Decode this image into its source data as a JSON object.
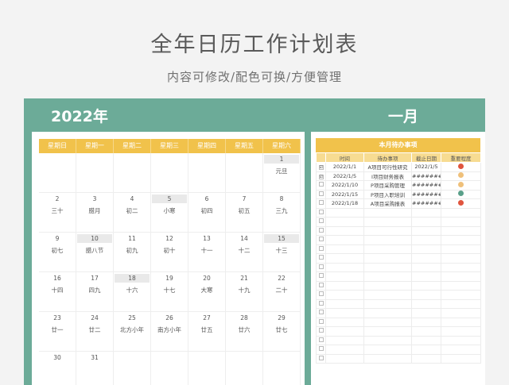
{
  "header": {
    "title": "全年日历工作计划表",
    "subtitle": "内容可修改/配色可换/方便管理"
  },
  "calendar": {
    "year_label": "2022年",
    "weekdays": [
      "星期日",
      "星期一",
      "星期二",
      "星期三",
      "星期四",
      "星期五",
      "星期六"
    ],
    "weeks": [
      [
        {
          "d": "",
          "l": ""
        },
        {
          "d": "",
          "l": ""
        },
        {
          "d": "",
          "l": ""
        },
        {
          "d": "",
          "l": ""
        },
        {
          "d": "",
          "l": ""
        },
        {
          "d": "",
          "l": ""
        },
        {
          "d": "1",
          "l": "元旦",
          "h": true
        }
      ],
      [
        {
          "d": "2",
          "l": "三十"
        },
        {
          "d": "3",
          "l": "腊月"
        },
        {
          "d": "4",
          "l": "初二"
        },
        {
          "d": "5",
          "l": "小寒",
          "h": true
        },
        {
          "d": "6",
          "l": "初四"
        },
        {
          "d": "7",
          "l": "初五"
        },
        {
          "d": "8",
          "l": "三九"
        }
      ],
      [
        {
          "d": "9",
          "l": "初七"
        },
        {
          "d": "10",
          "l": "腊八节",
          "h": true
        },
        {
          "d": "11",
          "l": "初九"
        },
        {
          "d": "12",
          "l": "初十"
        },
        {
          "d": "13",
          "l": "十一"
        },
        {
          "d": "14",
          "l": "十二"
        },
        {
          "d": "15",
          "l": "十三",
          "h": true
        }
      ],
      [
        {
          "d": "16",
          "l": "十四"
        },
        {
          "d": "17",
          "l": "四九"
        },
        {
          "d": "18",
          "l": "十六",
          "h": true
        },
        {
          "d": "19",
          "l": "十七"
        },
        {
          "d": "20",
          "l": "大寒"
        },
        {
          "d": "21",
          "l": "十九"
        },
        {
          "d": "22",
          "l": "二十"
        }
      ],
      [
        {
          "d": "23",
          "l": "廿一"
        },
        {
          "d": "24",
          "l": "廿二"
        },
        {
          "d": "25",
          "l": "北方小年"
        },
        {
          "d": "26",
          "l": "南方小年"
        },
        {
          "d": "27",
          "l": "廿五"
        },
        {
          "d": "28",
          "l": "廿六"
        },
        {
          "d": "29",
          "l": "廿七"
        }
      ],
      [
        {
          "d": "30",
          "l": ""
        },
        {
          "d": "31",
          "l": ""
        },
        {
          "d": "",
          "l": ""
        },
        {
          "d": "",
          "l": ""
        },
        {
          "d": "",
          "l": ""
        },
        {
          "d": "",
          "l": ""
        },
        {
          "d": "",
          "l": ""
        }
      ]
    ]
  },
  "todo": {
    "month_label": "一月",
    "heading": "本月待办事项",
    "columns": [
      "时间",
      "待办事项",
      "截止日期",
      "重要程度"
    ],
    "rows": [
      {
        "checked": true,
        "date": "2022/1/1",
        "task": "A项目可行性研究",
        "due": "2022/1/5",
        "color": "#e0553e"
      },
      {
        "checked": true,
        "date": "2022/1/5",
        "task": "I项目财务报表",
        "due": "########",
        "color": "#efc07a"
      },
      {
        "checked": false,
        "date": "2022/1/10",
        "task": "P项目采购管理",
        "due": "########",
        "color": "#efc07a"
      },
      {
        "checked": false,
        "date": "2022/1/15",
        "task": "P项目入职培训",
        "due": "########",
        "color": "#5aa08a"
      },
      {
        "checked": false,
        "date": "2022/1/18",
        "task": "A项目采购报表",
        "due": "########",
        "color": "#e0553e"
      }
    ],
    "empty_rows": 17,
    "check_glyph": "☑"
  }
}
